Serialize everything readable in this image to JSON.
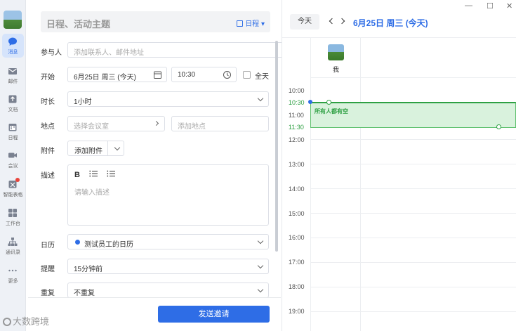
{
  "nav": {
    "items": [
      {
        "label": "消息",
        "icon": "chat-icon"
      },
      {
        "label": "邮件",
        "icon": "mail-icon"
      },
      {
        "label": "文档",
        "icon": "doc-icon"
      },
      {
        "label": "日程",
        "icon": "calendar-icon"
      },
      {
        "label": "会议",
        "icon": "video-icon"
      },
      {
        "label": "智能表格",
        "icon": "smart-sheet-icon"
      },
      {
        "label": "工作台",
        "icon": "grid-icon"
      },
      {
        "label": "通讯录",
        "icon": "org-icon"
      },
      {
        "label": "更多",
        "icon": "more-icon"
      }
    ],
    "accent": "#2e6de6"
  },
  "form": {
    "subject_placeholder": "日程、活动主题",
    "calendar_switch": "日程",
    "attendees": {
      "label": "参与人",
      "placeholder": "添加联系人、邮件地址"
    },
    "start": {
      "label": "开始",
      "date": "6月25日 周三 (今天)",
      "time": "10:30",
      "all_day": "全天"
    },
    "duration": {
      "label": "时长",
      "value": "1小时"
    },
    "location": {
      "label": "地点",
      "room_placeholder": "选择会议室",
      "address_placeholder": "添加地点"
    },
    "attachment": {
      "label": "附件",
      "button": "添加附件"
    },
    "description": {
      "label": "描述",
      "bold": "B",
      "placeholder": "请输入描述"
    },
    "calendar": {
      "label": "日历",
      "value": "测试员工的日历",
      "dot_color": "#2e6de6"
    },
    "reminder": {
      "label": "提醒",
      "value": "15分钟前"
    },
    "repeat": {
      "label": "重复",
      "value": "不重复"
    },
    "send_button": "发送邀请"
  },
  "calendar": {
    "today_button": "今天",
    "title": "6月25日 周三 (今天)",
    "attendee_name": "我",
    "times": [
      "10:00",
      "10:30",
      "11:00",
      "11:30",
      "12:00",
      "13:00",
      "14:00",
      "15:00",
      "16:00",
      "17:00",
      "18:00",
      "19:00"
    ],
    "event_text": "所有人都有空",
    "event_color": "#2ea043"
  },
  "watermark": "大数跨境"
}
